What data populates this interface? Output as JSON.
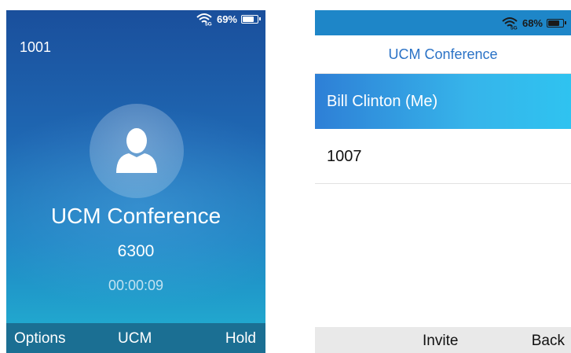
{
  "left_screen": {
    "status": {
      "wifi_label": "5G",
      "battery_percent": "69%",
      "battery_level": 0.69
    },
    "line_number": "1001",
    "call": {
      "name": "UCM Conference",
      "number": "6300",
      "timer": "00:00:09"
    },
    "softkeys": {
      "left": "Options",
      "middle": "UCM",
      "right": "Hold"
    },
    "colors": {
      "gradient_top": "#1a4f9c",
      "gradient_bottom": "#22b3d2",
      "softkey_bar": "#1b6f93"
    }
  },
  "right_screen": {
    "status": {
      "wifi_label": "5G",
      "battery_percent": "68%",
      "battery_level": 0.68
    },
    "title": "UCM Conference",
    "participants": [
      {
        "label": "Bill Clinton (Me)",
        "selected": true
      },
      {
        "label": "1007",
        "selected": false
      }
    ],
    "softkeys": {
      "middle": "Invite",
      "right": "Back"
    },
    "colors": {
      "status_bar": "#1e86c8",
      "title": "#2a72c6",
      "selection": "#36b4ea"
    }
  }
}
